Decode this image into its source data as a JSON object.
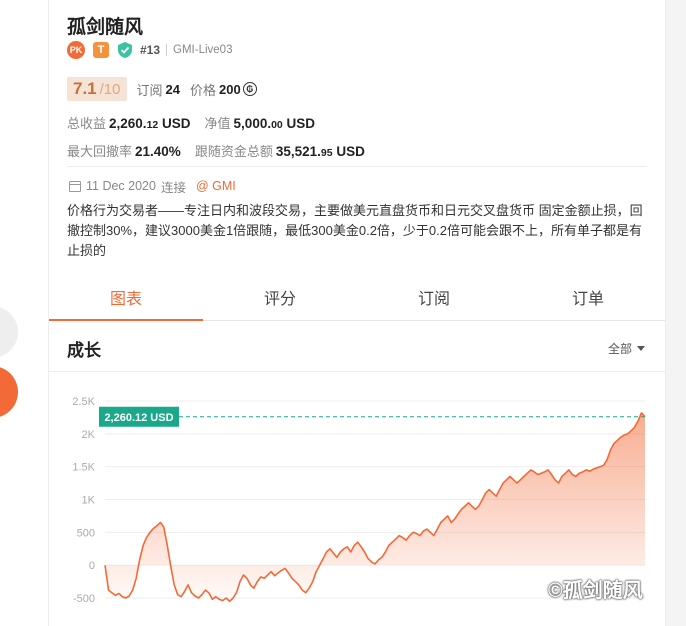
{
  "profile": {
    "name": "孤剑随风",
    "badge_pk": "PK",
    "badge_t": "T",
    "rank": "#13",
    "server": "GMI-Live03",
    "score": "7.1",
    "score_max": "/10",
    "subscribe_label": "订阅",
    "subscribe_count": "24",
    "price_label": "价格",
    "price_value": "200",
    "coin_symbol": "₲"
  },
  "stats": {
    "total_profit_label": "总收益",
    "total_profit_main": "2,260.",
    "total_profit_dec": "12",
    "total_profit_unit": "USD",
    "net_label": "净值",
    "net_main": "5,000.",
    "net_dec": "00",
    "net_unit": "USD",
    "drawdown_label": "最大回撤率",
    "drawdown_value": "21.40%",
    "follow_label": "跟随资金总额",
    "follow_main": "35,521.",
    "follow_dec": "95",
    "follow_unit": "USD"
  },
  "connection": {
    "date": "11 Dec 2020",
    "label": "连接",
    "broker": "@ GMI"
  },
  "description": "价格行为交易者——专注日内和波段交易，主要做美元直盘货币和日元交叉盘货币 固定金额止损，回撤控制30%，建议3000美金1倍跟随，最低300美金0.2倍，少于0.2倍可能会跟不上，所有单子都是有止损的",
  "tabs": [
    "图表",
    "评分",
    "订阅",
    "订单"
  ],
  "growth": {
    "title": "成长",
    "range_label": "全部"
  },
  "chart_data": {
    "type": "area",
    "yticks": [
      "2.5K",
      "2K",
      "1.5K",
      "1K",
      "500",
      "0",
      "-500"
    ],
    "ylim": [
      -500,
      2500
    ],
    "current_label": "2,260.12 USD",
    "current_value": 2260.12,
    "colors": {
      "line": "#f26a37",
      "marker": "#1aa88a"
    },
    "values": [
      0,
      -380,
      -420,
      -460,
      -430,
      -480,
      -500,
      -470,
      -380,
      -200,
      80,
      300,
      420,
      500,
      560,
      600,
      650,
      580,
      300,
      -20,
      -300,
      -450,
      -480,
      -400,
      -300,
      -420,
      -470,
      -500,
      -450,
      -380,
      -420,
      -520,
      -480,
      -520,
      -540,
      -500,
      -550,
      -500,
      -420,
      -250,
      -150,
      -200,
      -300,
      -350,
      -250,
      -180,
      -200,
      -150,
      -100,
      -160,
      -120,
      -80,
      -50,
      -120,
      -200,
      -250,
      -300,
      -380,
      -420,
      -350,
      -250,
      -100,
      0,
      100,
      200,
      250,
      180,
      120,
      200,
      250,
      280,
      200,
      300,
      350,
      280,
      200,
      100,
      50,
      20,
      80,
      120,
      200,
      300,
      350,
      400,
      450,
      420,
      380,
      450,
      500,
      480,
      450,
      520,
      550,
      500,
      450,
      550,
      650,
      700,
      750,
      650,
      700,
      780,
      850,
      900,
      950,
      900,
      850,
      900,
      1000,
      1100,
      1150,
      1100,
      1050,
      1150,
      1250,
      1300,
      1350,
      1300,
      1250,
      1300,
      1350,
      1400,
      1450,
      1420,
      1380,
      1400,
      1420,
      1450,
      1380,
      1300,
      1250,
      1350,
      1400,
      1450,
      1380,
      1350,
      1400,
      1420,
      1450,
      1430,
      1460,
      1480,
      1500,
      1520,
      1600,
      1750,
      1850,
      1900,
      1950,
      1980,
      2000,
      2050,
      2100,
      2200,
      2320,
      2260
    ]
  }
}
